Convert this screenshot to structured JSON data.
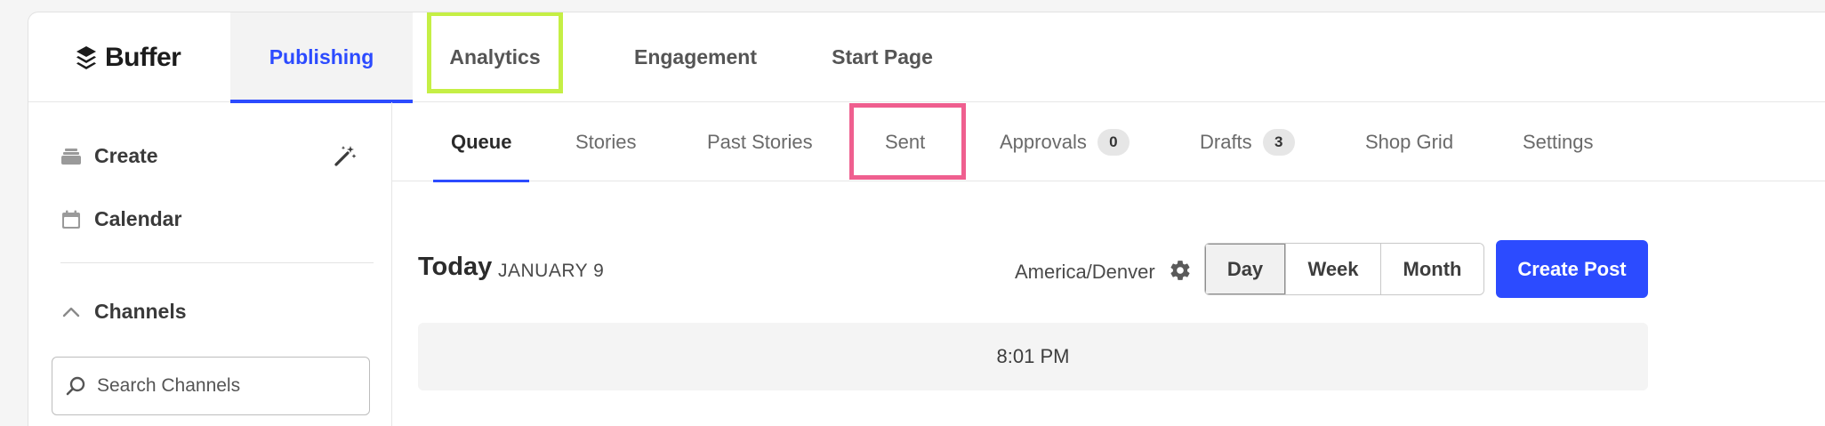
{
  "app": {
    "logo_text": "Buffer",
    "nav": {
      "publishing": "Publishing",
      "analytics": "Analytics",
      "engagement": "Engagement",
      "start_page": "Start Page"
    }
  },
  "sidebar": {
    "create": "Create",
    "calendar": "Calendar",
    "channels": "Channels",
    "search_placeholder": "Search Channels"
  },
  "subtabs": {
    "queue": "Queue",
    "stories": "Stories",
    "past_stories": "Past Stories",
    "sent": "Sent",
    "approvals": "Approvals",
    "approvals_count": "0",
    "drafts": "Drafts",
    "drafts_count": "3",
    "shop_grid": "Shop Grid",
    "settings": "Settings"
  },
  "content": {
    "day_title": "Today",
    "day_date": "JANUARY 9",
    "timezone": "America/Denver",
    "views": {
      "day": "Day",
      "week": "Week",
      "month": "Month"
    },
    "active_view": "Day",
    "create_post": "Create Post",
    "time_slot": "8:01 PM"
  },
  "colors": {
    "accent": "#2c4bff",
    "highlight_green": "#c5ef45",
    "highlight_pink": "#ef5f8f"
  },
  "icons": [
    "buffer-logo-icon",
    "stack-icon",
    "magic-wand-icon",
    "calendar-icon",
    "chevron-up-icon",
    "search-icon",
    "gear-icon"
  ]
}
